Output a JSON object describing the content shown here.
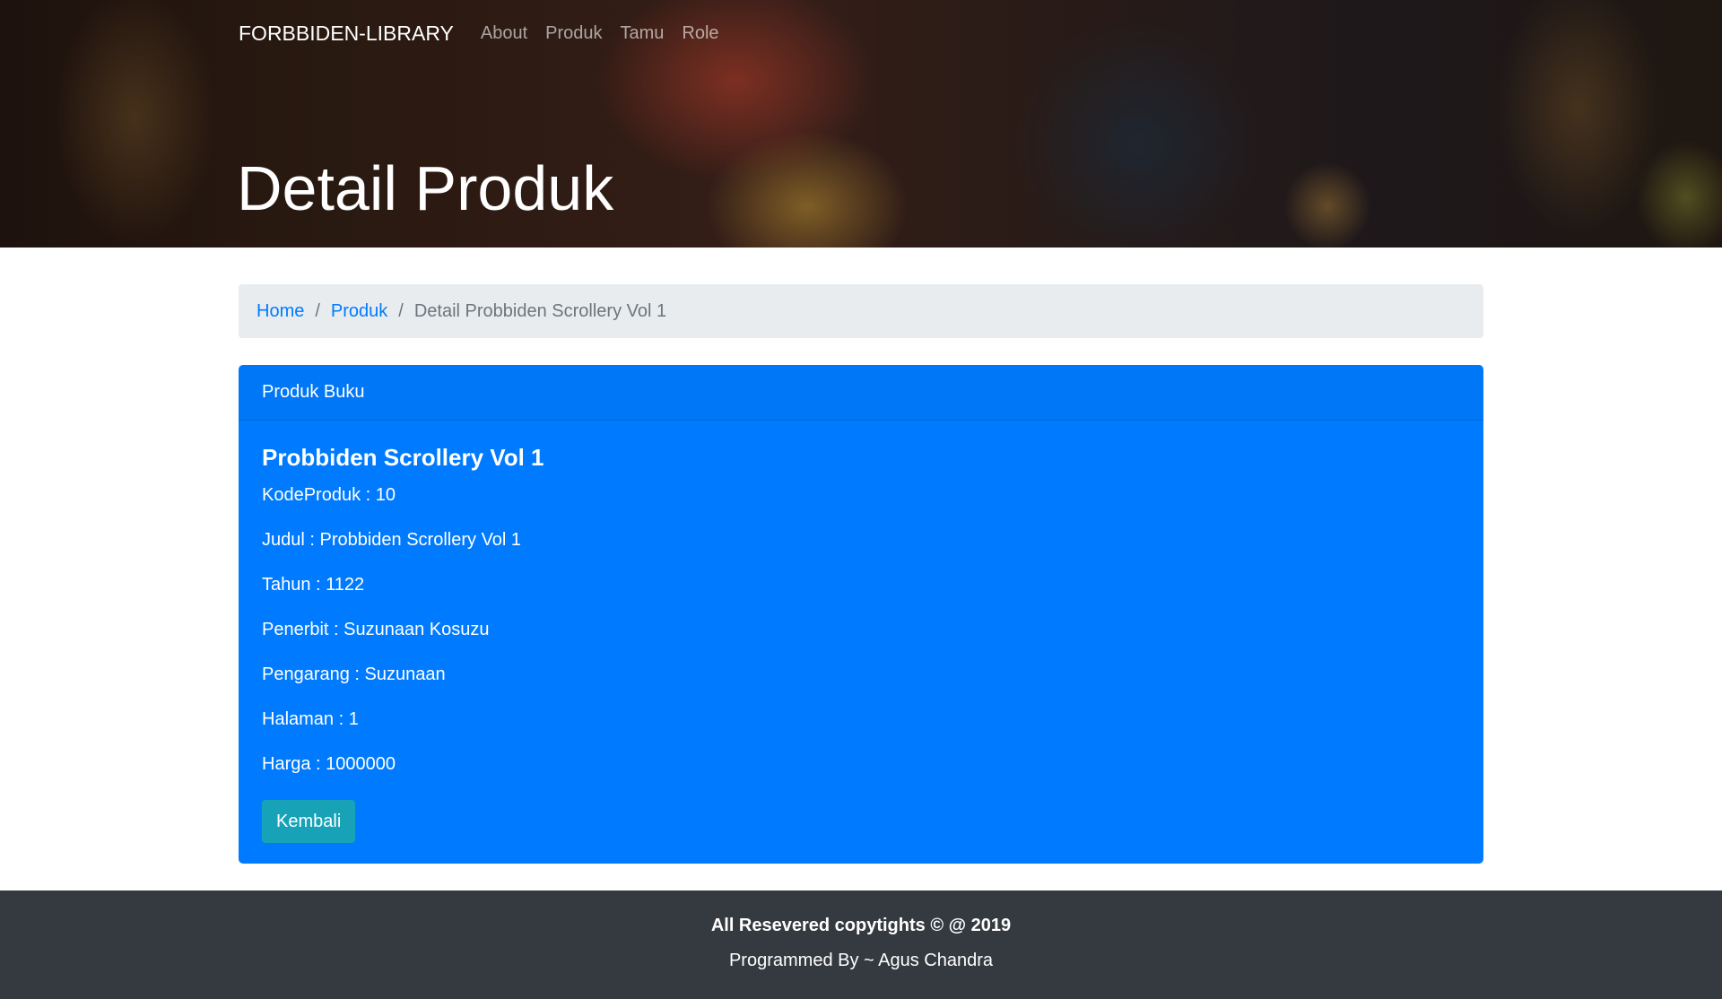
{
  "navbar": {
    "brand": "FORBBIDEN-LIBRARY",
    "links": [
      "About",
      "Produk",
      "Tamu",
      "Role"
    ]
  },
  "hero": {
    "title": "Detail Produk"
  },
  "breadcrumb": {
    "items": [
      "Home",
      "Produk"
    ],
    "separator": "/",
    "active": "Detail Probbiden Scrollery Vol 1"
  },
  "card": {
    "header": "Produk Buku",
    "title": "Probbiden Scrollery Vol 1",
    "fields": [
      "KodeProduk : 10",
      "Judul : Probbiden Scrollery Vol 1",
      "Tahun : 1122",
      "Penerbit : Suzunaan Kosuzu",
      "Pengarang : Suzunaan",
      "Halaman : 1",
      "Harga : 1000000"
    ],
    "button": "Kembali"
  },
  "footer": {
    "copyright": "All Resevered copytights © @ 2019",
    "programmed": "Programmed By ~ Agus Chandra"
  },
  "colors": {
    "primary": "#007bff",
    "info": "#17a2b8",
    "dark": "#343a40",
    "breadcrumb_bg": "#e9ecef"
  }
}
